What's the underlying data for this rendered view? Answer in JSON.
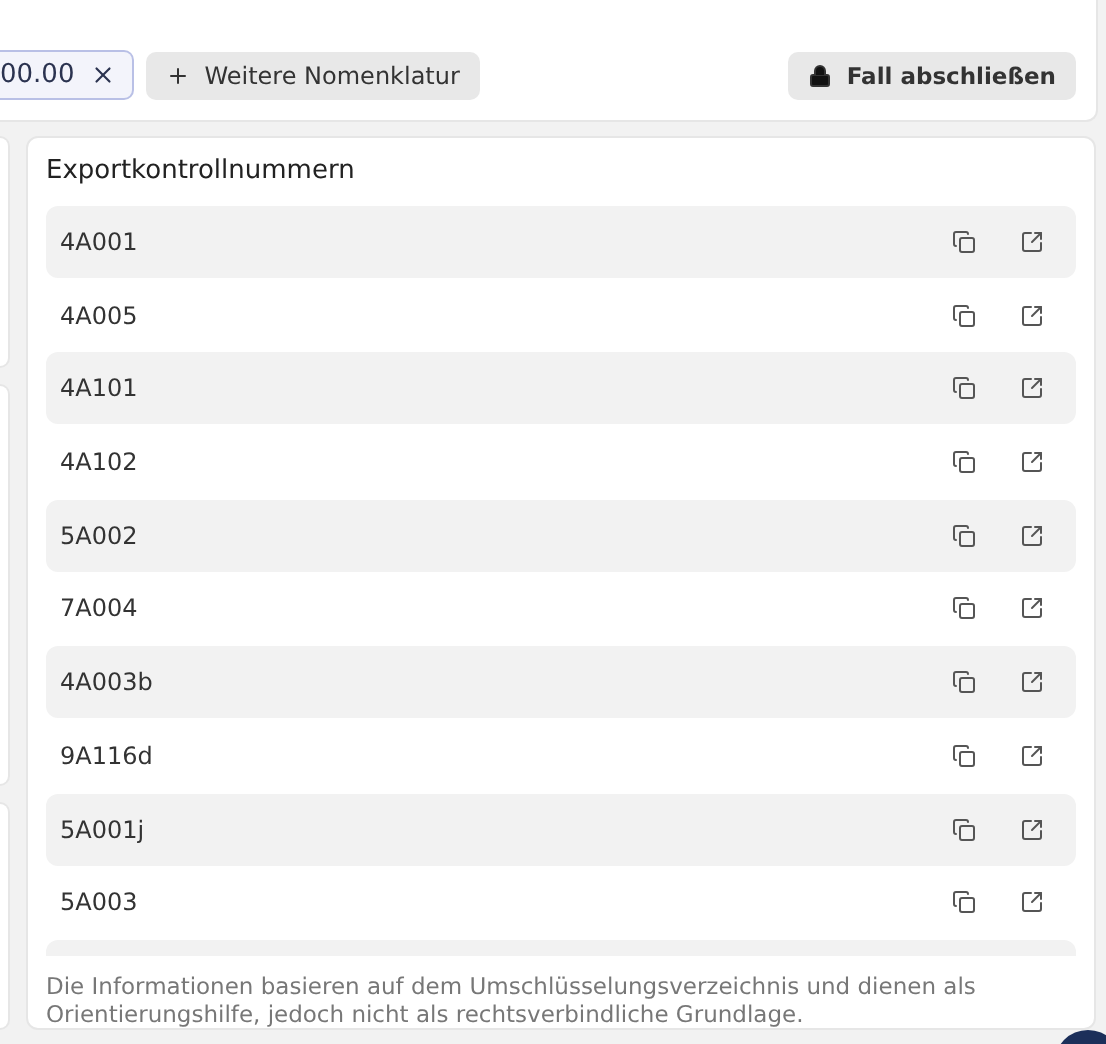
{
  "toolbar": {
    "chip": {
      "label": "00.00"
    },
    "add_button": {
      "label": "Weitere Nomenklatur"
    },
    "close_case_button": {
      "label": "Fall abschließen"
    }
  },
  "export_panel": {
    "title": "Exportkontrollnummern",
    "items": [
      {
        "code": "4A001"
      },
      {
        "code": "4A005"
      },
      {
        "code": "4A101"
      },
      {
        "code": "4A102"
      },
      {
        "code": "5A002"
      },
      {
        "code": "7A004"
      },
      {
        "code": "4A003b"
      },
      {
        "code": "9A116d"
      },
      {
        "code": "5A001j"
      },
      {
        "code": "5A003"
      }
    ],
    "footnote": "Die Informationen basieren auf dem Umschlüsselungsverzeichnis und dienen als Orientierungshilfe, jedoch nicht als rechtsverbindliche Grundlage."
  }
}
